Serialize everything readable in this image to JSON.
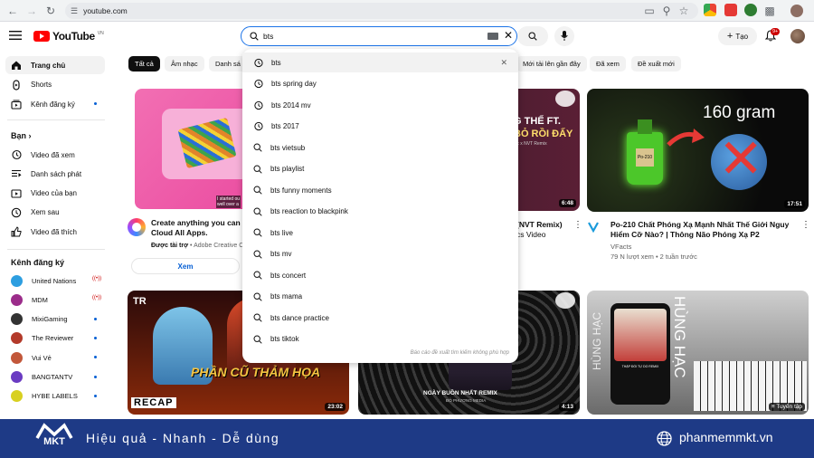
{
  "browser": {
    "url": "youtube.com"
  },
  "header": {
    "logo_text": "YouTube",
    "logo_region": "VN",
    "search_value": "bts",
    "create_label": "Tạo",
    "notif_count": "9+"
  },
  "sidebar": {
    "main": [
      {
        "label": "Trang chủ",
        "icon": "home-icon"
      },
      {
        "label": "Shorts",
        "icon": "shorts-icon"
      },
      {
        "label": "Kênh đăng ký",
        "icon": "subscriptions-icon"
      }
    ],
    "you_heading": "Bạn",
    "you": [
      {
        "label": "Video đã xem",
        "icon": "history-icon"
      },
      {
        "label": "Danh sách phát",
        "icon": "playlist-icon"
      },
      {
        "label": "Video của bạn",
        "icon": "your-videos-icon"
      },
      {
        "label": "Xem sau",
        "icon": "watch-later-icon"
      },
      {
        "label": "Video đã thích",
        "icon": "like-icon"
      }
    ],
    "subs_heading": "Kênh đăng ký",
    "subs": [
      {
        "label": "United Nations",
        "color": "#2d9ee0",
        "status": "live"
      },
      {
        "label": "MDM",
        "color": "#9b2c8a",
        "status": "live"
      },
      {
        "label": "MixiGaming",
        "color": "#333333",
        "status": "dot"
      },
      {
        "label": "The Reviewer",
        "color": "#b33a2a",
        "status": "dot"
      },
      {
        "label": "Vui Vẻ",
        "color": "#c2573a",
        "status": "dot"
      },
      {
        "label": "BANGTANTV",
        "color": "#6a3bc2",
        "status": "dot"
      },
      {
        "label": "HYBE LABELS",
        "color": "#d8d020",
        "status": "dot"
      }
    ]
  },
  "chips": [
    {
      "label": "Tất cả",
      "active": true
    },
    {
      "label": "Âm nhạc",
      "active": false
    },
    {
      "label": "Danh sá",
      "active": false
    },
    {
      "label": "Mới tải lên gần đây",
      "active": false
    },
    {
      "label": "Đã xem",
      "active": false
    },
    {
      "label": "Đề xuất mới",
      "active": false
    }
  ],
  "suggestions": {
    "items": [
      {
        "text": "bts",
        "history": true,
        "remove": true
      },
      {
        "text": "bts spring day",
        "history": true
      },
      {
        "text": "bts 2014 mv",
        "history": true
      },
      {
        "text": "bts 2017",
        "history": true
      },
      {
        "text": "bts vietsub",
        "history": false
      },
      {
        "text": "bts playlist",
        "history": false
      },
      {
        "text": "bts funny moments",
        "history": false
      },
      {
        "text": "bts reaction to blackpink",
        "history": false
      },
      {
        "text": "bts live",
        "history": false
      },
      {
        "text": "bts mv",
        "history": false
      },
      {
        "text": "bts concert",
        "history": false
      },
      {
        "text": "bts mama",
        "history": false
      },
      {
        "text": "bts dance practice",
        "history": false
      },
      {
        "text": "bts tiktok",
        "history": false
      }
    ],
    "report": "Báo cáo đề xuất tìm kiếm không phù hợp"
  },
  "cards": {
    "ad": {
      "title_line1": "Create anything you can i",
      "title_line2": "Cloud All Apps.",
      "sponsor": "Được tài trợ",
      "advertiser": "Adobe Creative C",
      "cta": "Xem",
      "caption": "I started ou\nwell over a"
    },
    "card2": {
      "title_line1": "(NVT Remix)",
      "title_line2": "cs Video",
      "duration": "6:48",
      "thumb_text1": "G THẾ FT.",
      "thumb_text2": "BỎ RỒI ĐẤY",
      "thumb_small": "Ạc x NVT Remix"
    },
    "card3": {
      "title_line1": "Po-210 Chất Phóng Xạ Mạnh Nhất Thế Giới Nguy",
      "title_line2": "Hiểm Cỡ Nào? | Thông Não Phóng Xạ P2",
      "channel": "VFacts",
      "meta": "79 N lượt xem • 2 tuần trước",
      "duration": "17:51",
      "thumb_text": "160 gram",
      "bottle_label": "Po-210"
    },
    "card4": {
      "duration": "23:02",
      "thumb_title": "PHẦN CŨ THẢM HỌA",
      "recap": "RECAP",
      "tag": "TR"
    },
    "card5": {
      "duration": "4:13",
      "thumb_title": "NGÀY BUỒN NHẤT REMIX",
      "thumb_sub": "ĐỖ PHƯƠNG MEDIA"
    },
    "card6": {
      "badge": "Tuyển tập",
      "thumb_left": "HÙNG HẠC",
      "thumb_right": "HÙNG HẠC",
      "phone_text": "THẬP ĐÓI TỰ DO REMIX"
    }
  },
  "banner": {
    "brand": "MKT",
    "slogan": "Hiệu quả - Nhanh - Dễ dùng",
    "website": "phanmemmkt.vn"
  }
}
